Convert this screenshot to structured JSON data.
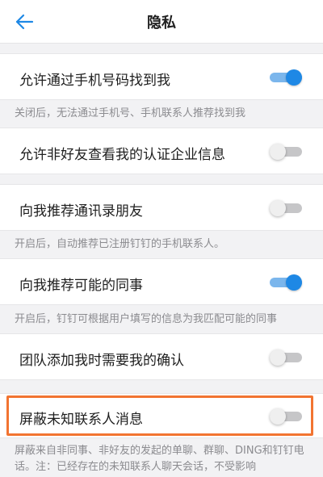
{
  "header": {
    "back_icon": "arrow-left-icon",
    "title": "隐私"
  },
  "settings": [
    {
      "label": "允许通过手机号码找到我",
      "enabled": true,
      "note": "关闭后，无法通过手机号、手机联系人推荐找到我"
    },
    {
      "label": "允许非好友查看我的认证企业信息",
      "enabled": false,
      "note": ""
    },
    {
      "label": "向我推荐通讯录朋友",
      "enabled": false,
      "note": "开启后，自动推荐已注册钉钉的手机联系人。"
    },
    {
      "label": "向我推荐可能的同事",
      "enabled": true,
      "note": "开启后，钉钉可根据用户填写的信息为我匹配可能的同事"
    },
    {
      "label": "团队添加我时需要我的确认",
      "enabled": false,
      "note": ""
    },
    {
      "label": "屏蔽未知联系人消息",
      "enabled": false,
      "note": "屏蔽来自非同事、非好友的发起的单聊、群聊、DING和钉钉电话。注：已经存在的未知联系人聊天会话，不受影响"
    }
  ],
  "colors": {
    "accent": "#1e88e5",
    "highlight": "#f27431"
  }
}
